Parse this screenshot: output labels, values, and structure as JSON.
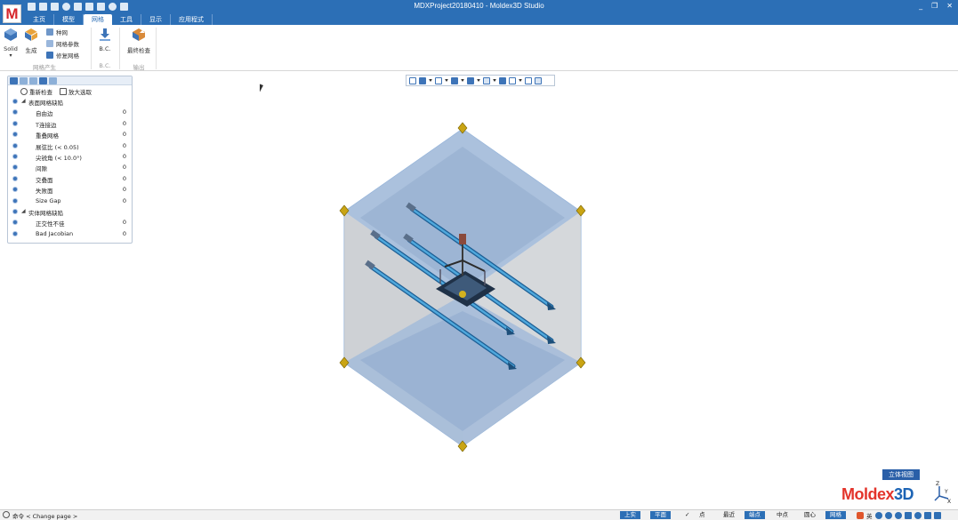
{
  "app": {
    "window_title": "MDXProject20180410 - Moldex3D Studio",
    "logo_letter": "M",
    "brand_word": "Moldex",
    "brand_suffix": "3D",
    "window_controls": [
      "_",
      "❐",
      "✕"
    ]
  },
  "tabs": [
    {
      "label": "主页",
      "active": false
    },
    {
      "label": "模型",
      "active": false
    },
    {
      "label": "网格",
      "active": true
    },
    {
      "label": "工具",
      "active": false
    },
    {
      "label": "显示",
      "active": false
    },
    {
      "label": "应用程式",
      "active": false
    }
  ],
  "ribbon": {
    "solid_label": "Solid",
    "generate_label": "生成",
    "seed_label": "种网",
    "mesh_params_label": "网格参数",
    "repair_mesh_label": "修复网格",
    "mesh_group_label": "网格产生",
    "bc_label": "B.C.",
    "bc_group_label": "B.C.",
    "export_label": "最终检查",
    "export_group_label": "输出"
  },
  "panel": {
    "recheck_label": "重新检查",
    "zoom_label": "放大选取",
    "rows": [
      {
        "label": "表面网格缺陷",
        "count": "",
        "level": 0
      },
      {
        "label": "自由边",
        "count": "0",
        "level": 1
      },
      {
        "label": "T连接边",
        "count": "0",
        "level": 1
      },
      {
        "label": "重叠网格",
        "count": "0",
        "level": 1
      },
      {
        "label": "展弦比 (< 0.05)",
        "count": "0",
        "level": 1
      },
      {
        "label": "尖锐角 (< 10.0°)",
        "count": "0",
        "level": 1
      },
      {
        "label": "间隙",
        "count": "0",
        "level": 1
      },
      {
        "label": "交叠面",
        "count": "0",
        "level": 1
      },
      {
        "label": "失败面",
        "count": "0",
        "level": 1
      },
      {
        "label": "Size Gap",
        "count": "0",
        "level": 1
      },
      {
        "label": "实体网格缺陷",
        "count": "",
        "level": 0
      },
      {
        "label": "正交性不佳",
        "count": "0",
        "level": 1
      },
      {
        "label": "Bad Jacobian",
        "count": "0",
        "level": 1
      }
    ]
  },
  "viewport": {
    "view_label": "立体视图",
    "axis_labels": {
      "z": "Z",
      "y": "Y",
      "x": "X"
    }
  },
  "statusbar": {
    "text": "命令 < Change page >",
    "buttons": [
      {
        "label": "上实",
        "on": true
      },
      {
        "label": "平面",
        "on": true
      },
      {
        "label": "✓",
        "on": false
      },
      {
        "label": "点",
        "on": false
      },
      {
        "label": "最近",
        "on": false
      },
      {
        "label": "端点",
        "on": true
      },
      {
        "label": "中点",
        "on": false
      },
      {
        "label": "圆心",
        "on": false
      },
      {
        "label": "网格",
        "on": true
      }
    ],
    "tray_text": "英"
  },
  "colors": {
    "accent": "#2c6fb6",
    "brand_red": "#e3342b",
    "brand_blue": "#1d64b5"
  }
}
